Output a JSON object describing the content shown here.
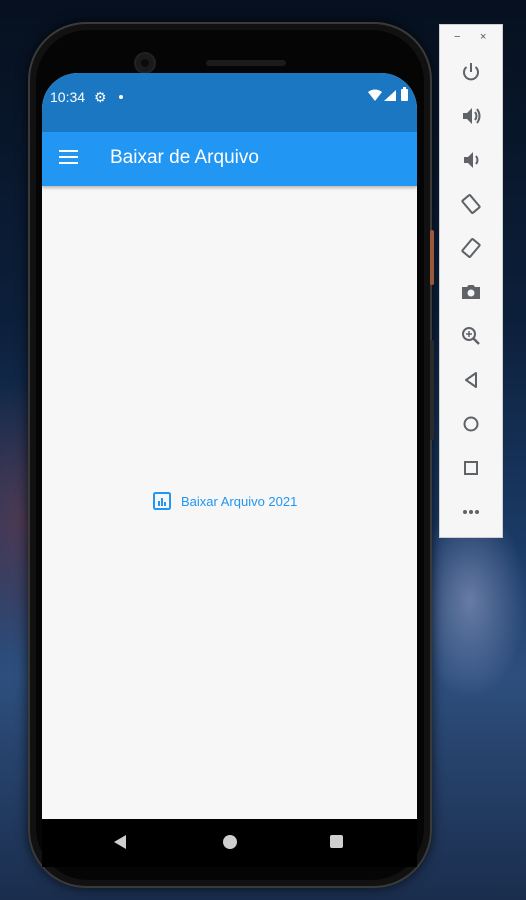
{
  "status_bar": {
    "time": "10:34"
  },
  "app_bar": {
    "title": "Baixar de Arquivo",
    "menu_icon": "hamburger-menu-icon"
  },
  "content": {
    "download_button_label": "Baixar Arquivo 2021",
    "download_icon": "bar-chart-icon"
  },
  "nav_bar": {
    "back_icon": "back-triangle-icon",
    "home_icon": "home-circle-icon",
    "recents_icon": "recents-square-icon"
  },
  "emulator_toolbar": {
    "minimize": "−",
    "close": "×",
    "items": [
      "power-icon",
      "volume-up-icon",
      "volume-down-icon",
      "rotate-left-icon",
      "rotate-right-icon",
      "camera-icon",
      "zoom-icon",
      "back-icon",
      "home-icon",
      "overview-icon",
      "more-icon"
    ]
  },
  "colors": {
    "status_bar": "#1b77c1",
    "app_bar": "#2196f3",
    "accent": "#2196f3",
    "background": "#f7f7f7"
  }
}
